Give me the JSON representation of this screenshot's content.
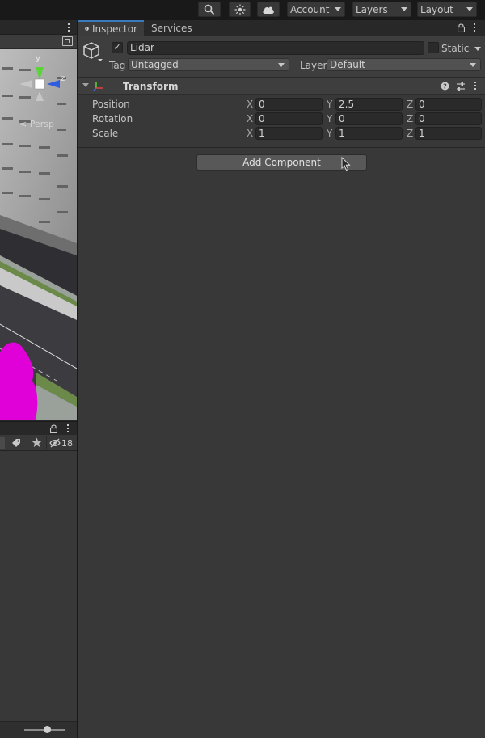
{
  "toolbar": {
    "account_label": "Account",
    "layers_label": "Layers",
    "layout_label": "Layout"
  },
  "inspector": {
    "tabs": {
      "inspector": "Inspector",
      "services": "Services"
    },
    "object": {
      "active": true,
      "name": "Lidar",
      "static_label": "Static",
      "tag_label": "Tag",
      "tag_value": "Untagged",
      "layer_label": "Layer",
      "layer_value": "Default"
    },
    "transform": {
      "title": "Transform",
      "rows": [
        {
          "label": "Position",
          "x": "0",
          "y": "2.5",
          "z": "0"
        },
        {
          "label": "Rotation",
          "x": "0",
          "y": "0",
          "z": "0"
        },
        {
          "label": "Scale",
          "x": "1",
          "y": "1",
          "z": "1"
        }
      ],
      "axis_x": "X",
      "axis_y": "Y",
      "axis_z": "Z"
    },
    "add_component_label": "Add Component"
  },
  "scene": {
    "gizmo_y": "y",
    "gizmo_z": "z",
    "persp_label": "< Persp"
  },
  "hierarchy": {
    "hidden_count": "18"
  },
  "colors": {
    "accent": "#3a79bb",
    "panel": "#383838",
    "field": "#2a2a2a",
    "dropdown": "#515151",
    "magenta_blob": "#e000d8",
    "gizmo_y": "#5bd33a",
    "gizmo_z": "#2f5de0"
  }
}
